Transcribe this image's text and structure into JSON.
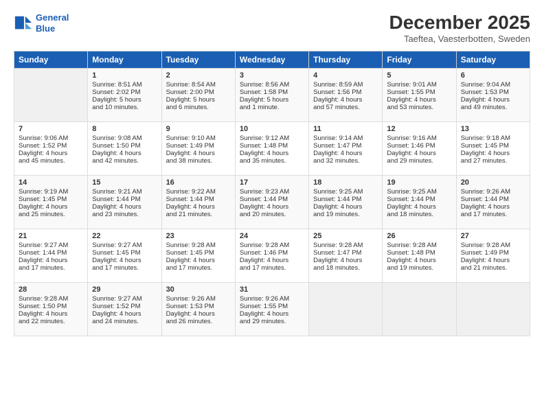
{
  "header": {
    "logo_line1": "General",
    "logo_line2": "Blue",
    "month_title": "December 2025",
    "subtitle": "Taeftea, Vaesterbotten, Sweden"
  },
  "days_of_week": [
    "Sunday",
    "Monday",
    "Tuesday",
    "Wednesday",
    "Thursday",
    "Friday",
    "Saturday"
  ],
  "weeks": [
    [
      {
        "day": "",
        "content": ""
      },
      {
        "day": "1",
        "content": "Sunrise: 8:51 AM\nSunset: 2:02 PM\nDaylight: 5 hours\nand 10 minutes."
      },
      {
        "day": "2",
        "content": "Sunrise: 8:54 AM\nSunset: 2:00 PM\nDaylight: 5 hours\nand 6 minutes."
      },
      {
        "day": "3",
        "content": "Sunrise: 8:56 AM\nSunset: 1:58 PM\nDaylight: 5 hours\nand 1 minute."
      },
      {
        "day": "4",
        "content": "Sunrise: 8:59 AM\nSunset: 1:56 PM\nDaylight: 4 hours\nand 57 minutes."
      },
      {
        "day": "5",
        "content": "Sunrise: 9:01 AM\nSunset: 1:55 PM\nDaylight: 4 hours\nand 53 minutes."
      },
      {
        "day": "6",
        "content": "Sunrise: 9:04 AM\nSunset: 1:53 PM\nDaylight: 4 hours\nand 49 minutes."
      }
    ],
    [
      {
        "day": "7",
        "content": "Sunrise: 9:06 AM\nSunset: 1:52 PM\nDaylight: 4 hours\nand 45 minutes."
      },
      {
        "day": "8",
        "content": "Sunrise: 9:08 AM\nSunset: 1:50 PM\nDaylight: 4 hours\nand 42 minutes."
      },
      {
        "day": "9",
        "content": "Sunrise: 9:10 AM\nSunset: 1:49 PM\nDaylight: 4 hours\nand 38 minutes."
      },
      {
        "day": "10",
        "content": "Sunrise: 9:12 AM\nSunset: 1:48 PM\nDaylight: 4 hours\nand 35 minutes."
      },
      {
        "day": "11",
        "content": "Sunrise: 9:14 AM\nSunset: 1:47 PM\nDaylight: 4 hours\nand 32 minutes."
      },
      {
        "day": "12",
        "content": "Sunrise: 9:16 AM\nSunset: 1:46 PM\nDaylight: 4 hours\nand 29 minutes."
      },
      {
        "day": "13",
        "content": "Sunrise: 9:18 AM\nSunset: 1:45 PM\nDaylight: 4 hours\nand 27 minutes."
      }
    ],
    [
      {
        "day": "14",
        "content": "Sunrise: 9:19 AM\nSunset: 1:45 PM\nDaylight: 4 hours\nand 25 minutes."
      },
      {
        "day": "15",
        "content": "Sunrise: 9:21 AM\nSunset: 1:44 PM\nDaylight: 4 hours\nand 23 minutes."
      },
      {
        "day": "16",
        "content": "Sunrise: 9:22 AM\nSunset: 1:44 PM\nDaylight: 4 hours\nand 21 minutes."
      },
      {
        "day": "17",
        "content": "Sunrise: 9:23 AM\nSunset: 1:44 PM\nDaylight: 4 hours\nand 20 minutes."
      },
      {
        "day": "18",
        "content": "Sunrise: 9:25 AM\nSunset: 1:44 PM\nDaylight: 4 hours\nand 19 minutes."
      },
      {
        "day": "19",
        "content": "Sunrise: 9:25 AM\nSunset: 1:44 PM\nDaylight: 4 hours\nand 18 minutes."
      },
      {
        "day": "20",
        "content": "Sunrise: 9:26 AM\nSunset: 1:44 PM\nDaylight: 4 hours\nand 17 minutes."
      }
    ],
    [
      {
        "day": "21",
        "content": "Sunrise: 9:27 AM\nSunset: 1:44 PM\nDaylight: 4 hours\nand 17 minutes."
      },
      {
        "day": "22",
        "content": "Sunrise: 9:27 AM\nSunset: 1:45 PM\nDaylight: 4 hours\nand 17 minutes."
      },
      {
        "day": "23",
        "content": "Sunrise: 9:28 AM\nSunset: 1:45 PM\nDaylight: 4 hours\nand 17 minutes."
      },
      {
        "day": "24",
        "content": "Sunrise: 9:28 AM\nSunset: 1:46 PM\nDaylight: 4 hours\nand 17 minutes."
      },
      {
        "day": "25",
        "content": "Sunrise: 9:28 AM\nSunset: 1:47 PM\nDaylight: 4 hours\nand 18 minutes."
      },
      {
        "day": "26",
        "content": "Sunrise: 9:28 AM\nSunset: 1:48 PM\nDaylight: 4 hours\nand 19 minutes."
      },
      {
        "day": "27",
        "content": "Sunrise: 9:28 AM\nSunset: 1:49 PM\nDaylight: 4 hours\nand 21 minutes."
      }
    ],
    [
      {
        "day": "28",
        "content": "Sunrise: 9:28 AM\nSunset: 1:50 PM\nDaylight: 4 hours\nand 22 minutes."
      },
      {
        "day": "29",
        "content": "Sunrise: 9:27 AM\nSunset: 1:52 PM\nDaylight: 4 hours\nand 24 minutes."
      },
      {
        "day": "30",
        "content": "Sunrise: 9:26 AM\nSunset: 1:53 PM\nDaylight: 4 hours\nand 26 minutes."
      },
      {
        "day": "31",
        "content": "Sunrise: 9:26 AM\nSunset: 1:55 PM\nDaylight: 4 hours\nand 29 minutes."
      },
      {
        "day": "",
        "content": ""
      },
      {
        "day": "",
        "content": ""
      },
      {
        "day": "",
        "content": ""
      }
    ]
  ]
}
